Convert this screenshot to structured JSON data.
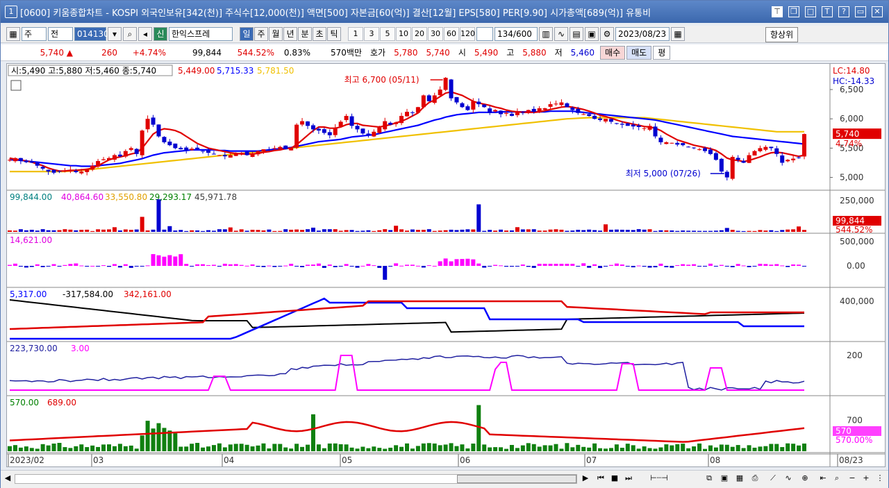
{
  "window": {
    "number": "1",
    "title": "[0600] 키움종합차트 - KOSPI 외국인보유[342(천)] 주식수[12,000(천)] 액면[500] 자본금[60(억)] 결산[12월] EPS[580] PER[9.90] 시가총액[689(억)] 유통비",
    "icons": [
      "pin-icon",
      "restore-icon",
      "maximize-icon",
      "font-icon",
      "help-icon",
      "minimize-icon",
      "close-icon"
    ]
  },
  "toolbar": {
    "period_select": "주",
    "prev_select": "전",
    "code": "014130",
    "credit_badge": "신",
    "stock_name": "한익스프레",
    "period_tabs": [
      "일",
      "주",
      "월",
      "년",
      "분",
      "초",
      "틱"
    ],
    "active_tab": "일",
    "intervals": [
      "1",
      "3",
      "5",
      "10",
      "20",
      "30",
      "60",
      "120"
    ],
    "count": "134/600",
    "date": "2023/08/23",
    "upper_limit_btn": "항상위"
  },
  "quote": {
    "price": "5,740",
    "change": "260",
    "change_pct": "+4.74%",
    "volume": "99,844",
    "volume_ratio": "544.52%",
    "turnover": "0.83%",
    "amount": "570백만",
    "ask_label": "호가",
    "ask1": "5,780",
    "ask2": "5,740",
    "open_label": "시",
    "open": "5,490",
    "high_label": "고",
    "high": "5,880",
    "low_label": "저",
    "low": "5,460",
    "buy_btn": "매수",
    "sell_btn": "매도",
    "eval_btn": "평"
  },
  "chart_data": [
    {
      "type": "candlestick",
      "title": "",
      "legend": "시:5,490 고:5,880 저:5,460 종:5,740",
      "ma_values": [
        "5,449.00",
        "5,715.33",
        "5,781.50"
      ],
      "ma_colors": [
        "#e00000",
        "#0000ff",
        "#f0c000"
      ],
      "yticks": [
        "6,500",
        "6,000",
        "5,500",
        "5,000"
      ],
      "ylim": [
        4900,
        6820
      ],
      "current_label": "5,740",
      "current_pct": "4.74%",
      "lc": "LC:14.80",
      "hc": "HC:-14.33",
      "high_annot": "최고 6,700 (05/11)",
      "low_annot": "최저 5,000 (07/26)",
      "x": [
        "2023/02",
        "03",
        "04",
        "05",
        "06",
        "07",
        "08",
        "08/23"
      ],
      "closes": [
        5300,
        5330,
        5280,
        5260,
        5250,
        5200,
        5150,
        5100,
        5080,
        5100,
        5120,
        5130,
        5090,
        5100,
        5150,
        5200,
        5280,
        5310,
        5330,
        5380,
        5360,
        5450,
        5500,
        5400,
        5800,
        6000,
        5900,
        5700,
        5600,
        5550,
        5500,
        5480,
        5460,
        5490,
        5480,
        5450,
        5420,
        5400,
        5380,
        5360,
        5380,
        5400,
        5420,
        5380,
        5400,
        5450,
        5480,
        5470,
        5500,
        5520,
        5480,
        5500,
        5900,
        5960,
        5880,
        5820,
        5800,
        5760,
        5720,
        5850,
        5950,
        6050,
        5880,
        5820,
        5750,
        5720,
        5780,
        5850,
        5960,
        5900,
        5940,
        6050,
        6120,
        6100,
        6200,
        6400,
        6300,
        6400,
        6500,
        6700,
        6350,
        6280,
        6200,
        6150,
        6300,
        6250,
        6200,
        6100,
        6150,
        6080,
        6100,
        6050,
        6120,
        6100,
        6150,
        6120,
        6180,
        6180,
        6250,
        6260,
        6280,
        6200,
        6150,
        6100,
        6080,
        6050,
        6000,
        5980,
        6000,
        5950,
        5920,
        5900,
        5880,
        5870,
        5860,
        5840,
        5880,
        5700,
        5600,
        5600,
        5590,
        5560,
        5550,
        5520,
        5500,
        5480,
        5450,
        5400,
        5300,
        5100,
        5000,
        5350,
        5300,
        5250,
        5380,
        5450,
        5500,
        5520,
        5500,
        5400,
        5250,
        5300,
        5320,
        5340,
        5740
      ],
      "ma5": [
        5330,
        5310,
        5300,
        5280,
        5260,
        5230,
        5200,
        5160,
        5130,
        5110,
        5110,
        5120,
        5120,
        5130,
        5140,
        5160,
        5200,
        5250,
        5300,
        5330,
        5350,
        5370,
        5400,
        5420,
        5500,
        5620,
        5740,
        5800,
        5830,
        5820,
        5800,
        5760,
        5700,
        5640,
        5580,
        5540,
        5500,
        5480,
        5460,
        5440,
        5420,
        5410,
        5400,
        5400,
        5400,
        5410,
        5430,
        5440,
        5460,
        5470,
        5490,
        5500,
        5560,
        5640,
        5720,
        5800,
        5860,
        5860,
        5840,
        5840,
        5860,
        5900,
        5920,
        5920,
        5890,
        5880,
        5870,
        5860,
        5880,
        5900,
        5930,
        5960,
        6000,
        6050,
        6100,
        6200,
        6280,
        6320,
        6380,
        6440,
        6460,
        6430,
        6400,
        6350,
        6300,
        6270,
        6250,
        6230,
        6200,
        6180,
        6150,
        6130,
        6120,
        6110,
        6110,
        6110,
        6120,
        6140,
        6160,
        6180,
        6200,
        6210,
        6200,
        6180,
        6160,
        6130,
        6100,
        6060,
        6040,
        6010,
        5980,
        5950,
        5930,
        5910,
        5890,
        5870,
        5860,
        5840,
        5800,
        5740,
        5690,
        5640,
        5610,
        5580,
        5550,
        5530,
        5510,
        5490,
        5460,
        5400,
        5330,
        5300,
        5290,
        5270,
        5290,
        5320,
        5350,
        5390,
        5420,
        5430,
        5420,
        5400,
        5380,
        5360,
        5380
      ],
      "ma20": [
        5300,
        5300,
        5290,
        5280,
        5270,
        5260,
        5250,
        5240,
        5230,
        5220,
        5210,
        5200,
        5200,
        5190,
        5190,
        5190,
        5200,
        5210,
        5220,
        5230,
        5240,
        5260,
        5280,
        5300,
        5320,
        5350,
        5380,
        5400,
        5420,
        5430,
        5440,
        5450,
        5460,
        5470,
        5470,
        5470,
        5470,
        5470,
        5460,
        5460,
        5450,
        5450,
        5450,
        5450,
        5450,
        5450,
        5460,
        5470,
        5480,
        5490,
        5500,
        5510,
        5530,
        5550,
        5570,
        5590,
        5610,
        5620,
        5630,
        5640,
        5650,
        5670,
        5690,
        5700,
        5710,
        5720,
        5730,
        5750,
        5770,
        5790,
        5810,
        5830,
        5850,
        5870,
        5890,
        5920,
        5950,
        5980,
        6000,
        6030,
        6050,
        6070,
        6080,
        6090,
        6100,
        6110,
        6110,
        6110,
        6110,
        6120,
        6120,
        6120,
        6120,
        6120,
        6120,
        6120,
        6120,
        6120,
        6130,
        6130,
        6130,
        6130,
        6130,
        6120,
        6110,
        6100,
        6090,
        6080,
        6070,
        6060,
        6050,
        6040,
        6030,
        6020,
        6010,
        6000,
        5990,
        5980,
        5960,
        5940,
        5920,
        5900,
        5880,
        5860,
        5840,
        5820,
        5800,
        5780,
        5760,
        5740,
        5720,
        5700,
        5690,
        5680,
        5670,
        5660,
        5650,
        5640,
        5630,
        5620,
        5610,
        5600,
        5590,
        5580,
        5570
      ],
      "ma60": [
        5100,
        5100,
        5100,
        5100,
        5100,
        5100,
        5100,
        5100,
        5100,
        5100,
        5100,
        5110,
        5110,
        5120,
        5130,
        5140,
        5150,
        5160,
        5170,
        5180,
        5190,
        5200,
        5210,
        5220,
        5230,
        5240,
        5250,
        5260,
        5270,
        5280,
        5290,
        5300,
        5310,
        5320,
        5330,
        5340,
        5350,
        5360,
        5370,
        5380,
        5390,
        5400,
        5410,
        5420,
        5430,
        5440,
        5450,
        5460,
        5470,
        5480,
        5490,
        5500,
        5510,
        5520,
        5530,
        5540,
        5550,
        5560,
        5570,
        5580,
        5590,
        5600,
        5610,
        5620,
        5630,
        5640,
        5650,
        5660,
        5670,
        5680,
        5690,
        5700,
        5710,
        5720,
        5730,
        5740,
        5750,
        5760,
        5770,
        5780,
        5790,
        5800,
        5810,
        5820,
        5830,
        5840,
        5850,
        5860,
        5870,
        5880,
        5890,
        5900,
        5910,
        5920,
        5930,
        5940,
        5950,
        5960,
        5970,
        5980,
        5990,
        6000,
        6005,
        6010,
        6015,
        6020,
        6020,
        6020,
        6020,
        6020,
        6020,
        6020,
        6020,
        6020,
        6020,
        6020,
        6010,
        6000,
        5990,
        5980,
        5970,
        5960,
        5950,
        5940,
        5930,
        5920,
        5910,
        5900,
        5890,
        5880,
        5870,
        5860,
        5850,
        5840,
        5830,
        5820,
        5810,
        5800,
        5790,
        5780,
        5780,
        5780,
        5780,
        5780,
        5781
      ]
    },
    {
      "type": "bar",
      "title": "",
      "values_legend": [
        "99,844.00",
        "40,864.60",
        "33,550.80",
        "29,293.17",
        "45,971.78"
      ],
      "legend_colors": [
        "#008080",
        "#e000e0",
        "#e0a000",
        "#008000",
        "#404040"
      ],
      "yticks": [
        "250,000"
      ],
      "ylim": [
        0,
        300000
      ],
      "current_label": "99,844",
      "current_pct": "544.52%"
    },
    {
      "type": "bar",
      "title": "",
      "legend": "14,621.00",
      "yticks": [
        "500,000",
        "0.00"
      ],
      "ylim": [
        -600000,
        800000
      ]
    },
    {
      "type": "line",
      "title": "",
      "series_legend": [
        "5,317.00",
        "-317,584.00",
        "342,161.00"
      ],
      "legend_colors": [
        "#0000ff",
        "#000000",
        "#e00000"
      ],
      "yticks": [
        "400,000"
      ],
      "ylim": [
        -600000,
        600000
      ]
    },
    {
      "type": "line",
      "title": "",
      "series_legend": [
        "223,730.00",
        "3.00"
      ],
      "legend_colors": [
        "#2020a0",
        "#ff00ff"
      ],
      "yticks": [
        "200"
      ],
      "ylim": [
        0,
        260
      ]
    },
    {
      "type": "bar",
      "title": "",
      "series_legend": [
        "570.00",
        "689.00"
      ],
      "legend_colors": [
        "#008000",
        "#e00000"
      ],
      "yticks": [
        "700"
      ],
      "ylim": [
        300,
        950
      ],
      "current_label": "570",
      "current_pct": "570.00%"
    }
  ],
  "x_axis": [
    "2023/02",
    "03",
    "04",
    "05",
    "06",
    "07",
    "08",
    "08/23"
  ],
  "statusbar": {
    "icons": [
      "first-icon",
      "next-icon",
      "stop-icon",
      "fast-forward-icon",
      "ruler-icon",
      "copy-icon",
      "zoom-icon",
      "minus-icon",
      "plus-icon",
      "settings-icon"
    ]
  }
}
